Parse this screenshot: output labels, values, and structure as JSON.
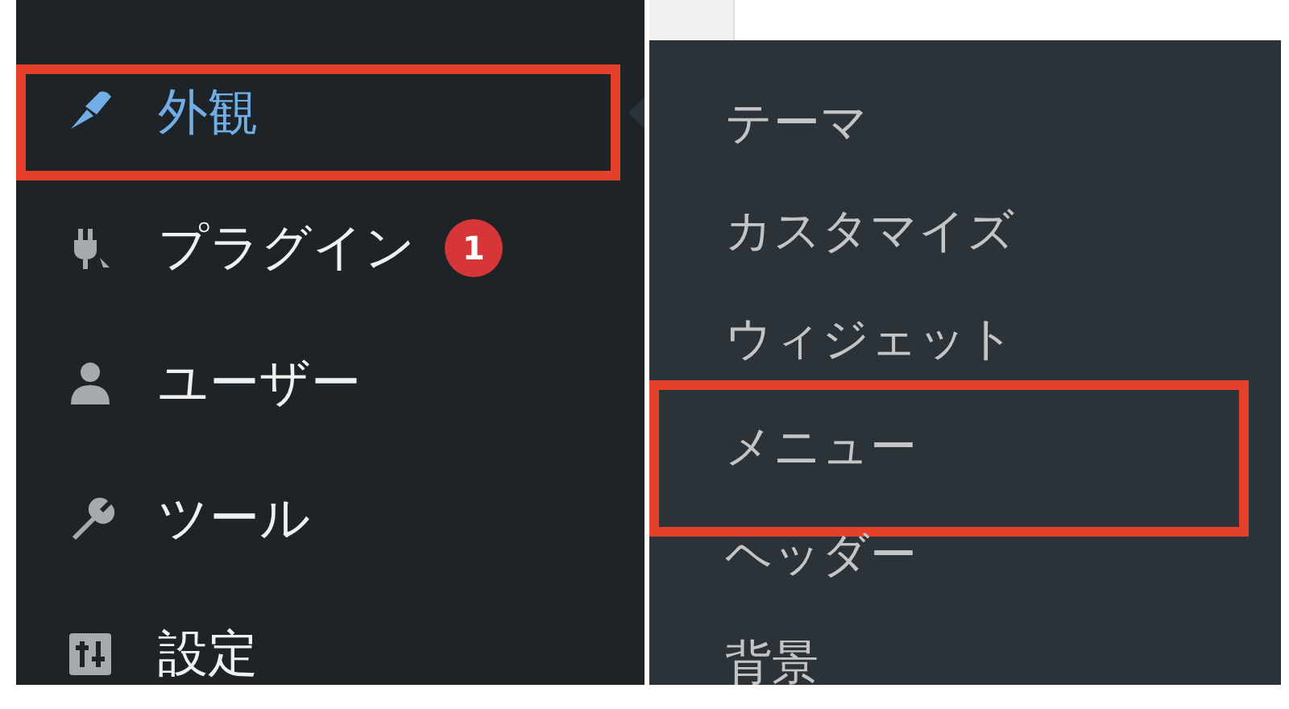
{
  "sidebar": {
    "items": [
      {
        "label": "外観",
        "selected": true,
        "highlighted": true
      },
      {
        "label": "プラグイン",
        "selected": false,
        "highlighted": false,
        "badge": "1"
      },
      {
        "label": "ユーザー",
        "selected": false,
        "highlighted": false
      },
      {
        "label": "ツール",
        "selected": false,
        "highlighted": false
      },
      {
        "label": "設定",
        "selected": false,
        "highlighted": false
      }
    ]
  },
  "submenu": {
    "items": [
      {
        "label": "テーマ",
        "highlighted": false
      },
      {
        "label": "カスタマイズ",
        "highlighted": false
      },
      {
        "label": "ウィジェット",
        "highlighted": false
      },
      {
        "label": "メニュー",
        "highlighted": true
      },
      {
        "label": "ヘッダー",
        "highlighted": false
      },
      {
        "label": "背景",
        "highlighted": false
      }
    ]
  }
}
